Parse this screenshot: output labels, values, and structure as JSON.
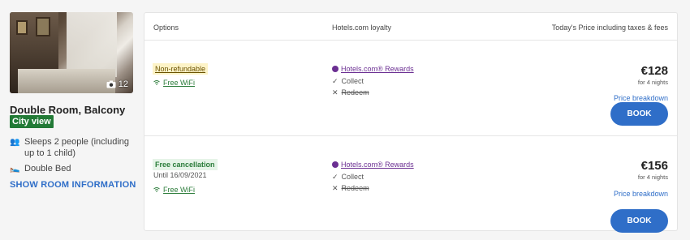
{
  "room": {
    "photo_count": "12",
    "title": "Double Room, Balcony",
    "view_badge": "City view",
    "sleeps": "Sleeps 2 people (including up to 1 child)",
    "bed": "Double Bed",
    "show_info": "SHOW ROOM INFORMATION"
  },
  "header": {
    "options": "Options",
    "loyalty": "Hotels.com loyalty",
    "price": "Today's Price including taxes & fees"
  },
  "options": [
    {
      "policy": "Non-refundable",
      "until": "",
      "wifi": "Free WiFi",
      "rewards": "Hotels.com® Rewards",
      "collect": "Collect",
      "redeem": "Redeem",
      "price": "€128",
      "nights": "for 4 nights",
      "breakdown": "Price breakdown",
      "book": "BOOK"
    },
    {
      "policy": "Free cancellation",
      "until": "Until 16/09/2021",
      "wifi": "Free WiFi",
      "rewards": "Hotels.com® Rewards",
      "collect": "Collect",
      "redeem": "Redeem",
      "price": "€156",
      "nights": "for 4 nights",
      "breakdown": "Price breakdown",
      "book": "BOOK"
    }
  ],
  "icons": {
    "camera": "camera-icon",
    "people": "people-icon",
    "bed": "bed-icon",
    "wifi": "wifi-icon",
    "rewards": "rewards-icon",
    "check": "check-icon",
    "cross": "cross-icon"
  },
  "colors": {
    "accent": "#2f6ec8",
    "view_badge": "#227a36",
    "rewards": "#6b2f92"
  }
}
